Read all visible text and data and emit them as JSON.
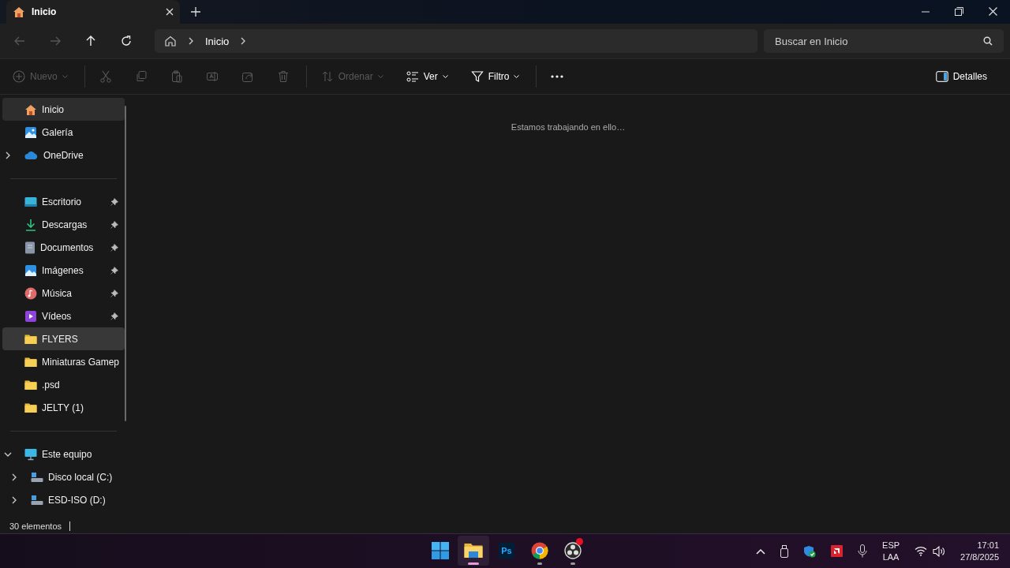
{
  "tabs": [
    {
      "title": "Inicio",
      "selected": true
    }
  ],
  "nav_buttons": [
    {
      "kind": "back",
      "disabled": true
    },
    {
      "kind": "forward",
      "disabled": true
    },
    {
      "kind": "up",
      "disabled": false
    },
    {
      "kind": "refresh",
      "disabled": false
    }
  ],
  "address": {
    "crumbs": [
      "Inicio"
    ]
  },
  "search": {
    "placeholder": "Buscar en Inicio"
  },
  "toolbar": {
    "groups": [
      [
        {
          "kind": "new",
          "label": "Nuevo",
          "dropdown": true,
          "disabled": true
        }
      ],
      [
        {
          "kind": "cut",
          "disabled": true
        },
        {
          "kind": "copy",
          "disabled": true
        },
        {
          "kind": "paste",
          "disabled": true
        },
        {
          "kind": "rename",
          "disabled": true
        },
        {
          "kind": "share",
          "disabled": true
        },
        {
          "kind": "delete",
          "disabled": true
        }
      ],
      [
        {
          "kind": "sort",
          "label": "Ordenar",
          "dropdown": true,
          "disabled": true
        },
        {
          "kind": "view",
          "label": "Ver",
          "dropdown": true,
          "disabled": false
        },
        {
          "kind": "filter",
          "label": "Filtro",
          "dropdown": true,
          "disabled": false
        }
      ],
      [
        {
          "kind": "more",
          "disabled": false
        }
      ]
    ],
    "details_button": {
      "label": "Detalles"
    }
  },
  "sidebar": {
    "sections": [
      [
        {
          "label": "Inicio",
          "kind": "home",
          "selected": true,
          "hovered": false
        },
        {
          "label": "Galería",
          "kind": "gallery",
          "selected": false,
          "hovered": false
        },
        {
          "label": "OneDrive",
          "kind": "cloud",
          "selected": false,
          "hovered": false,
          "expanded": false
        }
      ],
      [
        {
          "label": "Escritorio",
          "kind": "desktop",
          "selected": false,
          "hovered": false,
          "pinned": true
        },
        {
          "label": "Descargas",
          "kind": "download",
          "selected": false,
          "hovered": false,
          "pinned": true
        },
        {
          "label": "Documentos",
          "kind": "document",
          "selected": false,
          "hovered": false,
          "pinned": true
        },
        {
          "label": "Imágenes",
          "kind": "pictures",
          "selected": false,
          "hovered": false,
          "pinned": true
        },
        {
          "label": "Música",
          "kind": "music",
          "selected": false,
          "hovered": false,
          "pinned": true
        },
        {
          "label": "Vídeos",
          "kind": "video",
          "selected": false,
          "hovered": false,
          "pinned": true
        },
        {
          "label": "FLYERS",
          "kind": "folder",
          "selected": false,
          "hovered": true,
          "pinned": false
        },
        {
          "label": "Miniaturas Gamep",
          "kind": "folder",
          "selected": false,
          "hovered": false,
          "pinned": false
        },
        {
          "label": ".psd",
          "kind": "folder",
          "selected": false,
          "hovered": false,
          "pinned": false
        },
        {
          "label": "JELTY (1)",
          "kind": "folder",
          "selected": false,
          "hovered": false,
          "pinned": false
        }
      ],
      [
        {
          "label": "Este equipo",
          "kind": "pc",
          "selected": false,
          "hovered": false,
          "expanded": true,
          "children": [
            {
              "label": "Disco local (C:)",
              "kind": "drive",
              "selected": false,
              "hovered": false,
              "expanded": false
            },
            {
              "label": "ESD-ISO (D:)",
              "kind": "drive",
              "selected": false,
              "hovered": false,
              "expanded": false
            }
          ]
        }
      ]
    ]
  },
  "content": {
    "message": "Estamos trabajando en ello…"
  },
  "status_bar": {
    "item_count": "30 elementos"
  },
  "taskbar": {
    "apps": [
      {
        "kind": "start",
        "active": false,
        "running": false,
        "badge": false
      },
      {
        "kind": "explorer",
        "active": true,
        "running": true,
        "badge": false
      },
      {
        "kind": "photoshop",
        "label": "Ps",
        "active": false,
        "running": false,
        "badge": false
      },
      {
        "kind": "chrome",
        "active": false,
        "running": true,
        "badge": false
      },
      {
        "kind": "obs",
        "active": false,
        "running": true,
        "badge": true
      }
    ],
    "tray": {
      "language": [
        "ESP",
        "LAA"
      ],
      "time": "17:01",
      "date": "27/8/2025"
    }
  }
}
